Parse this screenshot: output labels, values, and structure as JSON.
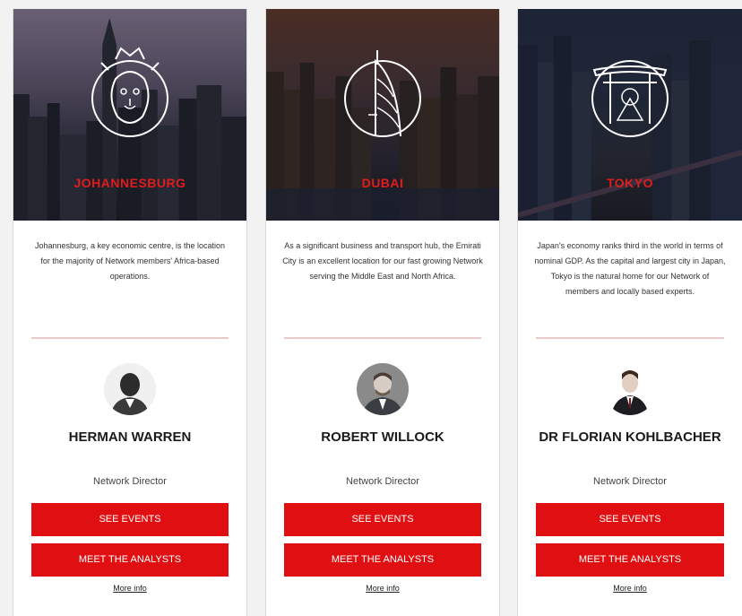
{
  "colors": {
    "accent": "#e00f12",
    "card_bg": "#ffffff",
    "page_bg": "#f2f2f2"
  },
  "cards": [
    {
      "city": "JOHANNESBURG",
      "emblem_icon": "lion-head-icon",
      "description": "Johannesburg, a key economic centre, is the location for the majority of Network members' Africa-based operations.",
      "person_name": "HERMAN WARREN",
      "role": "Network Director",
      "events_label": "SEE EVENTS",
      "analysts_label": "MEET THE ANALYSTS",
      "more_label": "More info"
    },
    {
      "city": "DUBAI",
      "emblem_icon": "burj-al-arab-icon",
      "description": "As a significant business and transport hub, the Emirati City is an excellent location for our fast growing Network serving the Middle East and North Africa.",
      "person_name": "ROBERT WILLOCK",
      "role": "Network Director",
      "events_label": "SEE EVENTS",
      "analysts_label": "MEET THE ANALYSTS",
      "more_label": "More info"
    },
    {
      "city": "TOKYO",
      "emblem_icon": "torii-gate-icon",
      "description": "Japan's economy ranks third in the world in terms of nominal GDP. As the capital and largest city in Japan, Tokyo is the natural home for our Network of members and locally based experts.",
      "person_name": "DR FLORIAN KOHLBACHER",
      "role": "Network Director",
      "events_label": "SEE EVENTS",
      "analysts_label": "MEET THE ANALYSTS",
      "more_label": "More info"
    }
  ]
}
